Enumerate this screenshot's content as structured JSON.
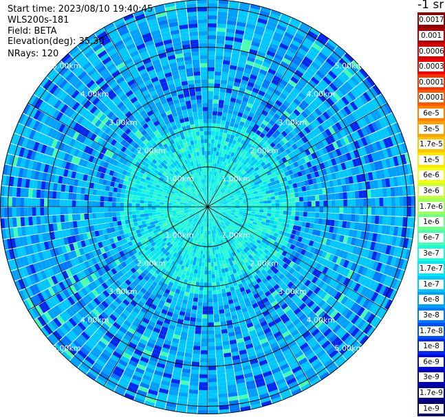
{
  "info": {
    "start": "Start time: 2023/08/10 19:40:45",
    "instrument": "WLS200s-181",
    "field": "Field: BETA",
    "elevation": "Elevation(deg): 35.30",
    "nrays": "NRays: 120"
  },
  "chart_data": {
    "type": "heatmap",
    "subtype": "polar-ppi",
    "field": "BETA",
    "nrays": 120,
    "max_range_km": 5.2,
    "range_rings_km": [
      1,
      2,
      3,
      4,
      5
    ],
    "range_ring_labels": [
      "1.00km",
      "2.00km",
      "3.00km",
      "4.00km",
      "5.00km"
    ],
    "spokes_deg": [
      0,
      30,
      60,
      90,
      120,
      150,
      180,
      210,
      240,
      270,
      300,
      330
    ],
    "colorbar": {
      "unit": "-1 sr",
      "labels": [
        "0.0017",
        "0.001",
        "0.0006",
        "0.0003",
        "0.00017",
        "0.0001",
        "6e-5",
        "3e-5",
        "1.7e-5",
        "1e-5",
        "6e-6",
        "3e-6",
        "1.7e-6",
        "1e-6",
        "6e-7",
        "3e-7",
        "1.7e-7",
        "1e-7",
        "6e-8",
        "3e-8",
        "1.7e-8",
        "1e-8",
        "6e-9",
        "3e-9",
        "1.7e-9",
        "1e-9"
      ],
      "colors": [
        "#8b0000",
        "#b00000",
        "#d40000",
        "#f00000",
        "#ff3000",
        "#ff5a00",
        "#ff8000",
        "#ffa000",
        "#ffc400",
        "#ffe800",
        "#f2ff10",
        "#c8ff38",
        "#a0ff5a",
        "#70ff88",
        "#48ffb0",
        "#20f8d8",
        "#00e8f0",
        "#00c8ff",
        "#00a0ff",
        "#0078ff",
        "#0050ff",
        "#0028f0",
        "#0008d8",
        "#0000b4",
        "#000090",
        "#00006c"
      ]
    },
    "dominant_levels": [
      "1e-8",
      "6e-8",
      "1e-7",
      "3e-7"
    ]
  }
}
